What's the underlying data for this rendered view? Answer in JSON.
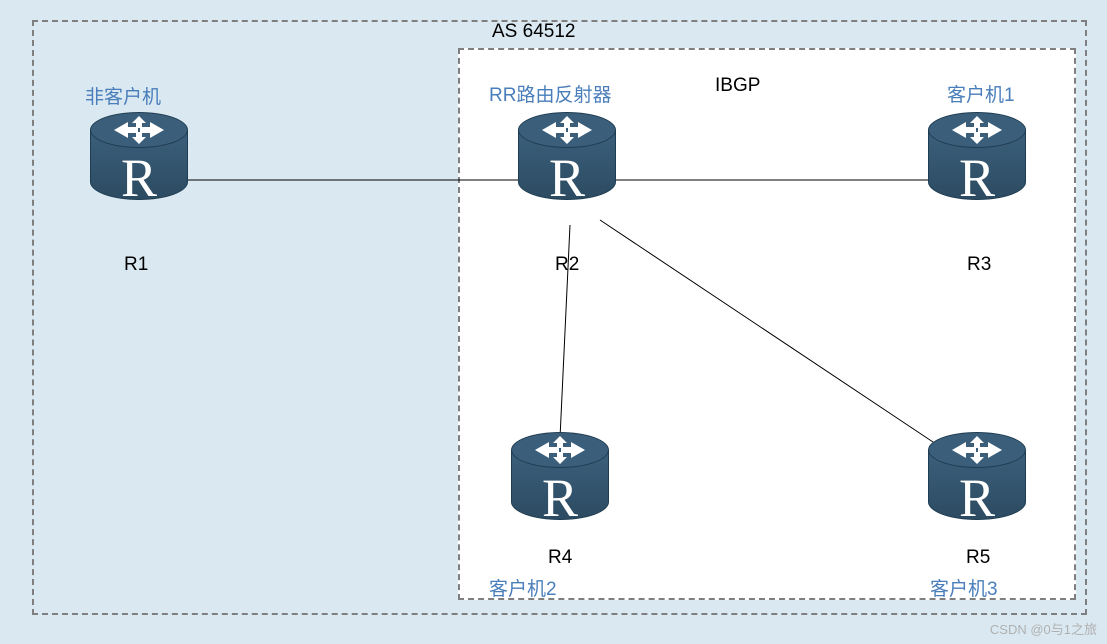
{
  "as_label": "AS 64512",
  "ibgp_label": "IBGP",
  "routers": {
    "r1": {
      "name": "R1",
      "role": "非客户机"
    },
    "r2": {
      "name": "R2",
      "role": "RR路由反射器"
    },
    "r3": {
      "name": "R3",
      "role": "客户机1"
    },
    "r4": {
      "name": "R4",
      "role": "客户机2"
    },
    "r5": {
      "name": "R5",
      "role": "客户机3"
    }
  },
  "watermark": "CSDN @0与1之旅",
  "links": [
    {
      "from": "R1",
      "to": "R2"
    },
    {
      "from": "R2",
      "to": "R3"
    },
    {
      "from": "R2",
      "to": "R4"
    },
    {
      "from": "R2",
      "to": "R5"
    }
  ]
}
